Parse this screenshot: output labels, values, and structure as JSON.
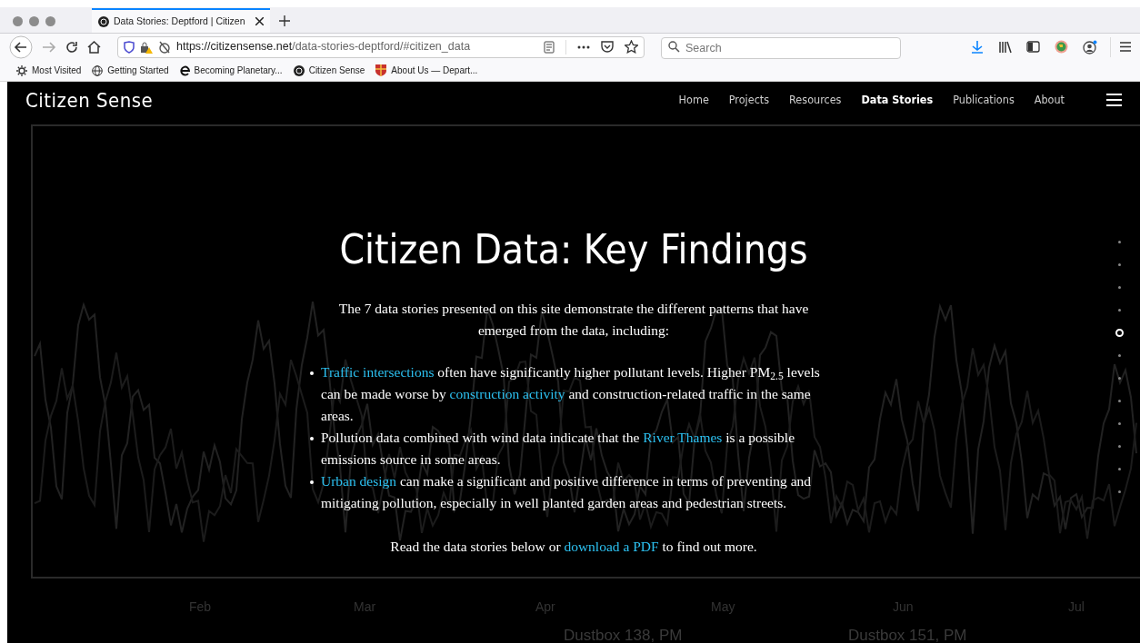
{
  "browser": {
    "tabs": [
      {
        "title": "Data Stories: Deptford | Citizen",
        "selected": true
      }
    ],
    "url": {
      "host": "https://citizensense.net",
      "path": "/data-stories-deptford/#citizen_data"
    },
    "search": {
      "placeholder": "Search"
    },
    "bookmarks": [
      {
        "label": "Most Visited",
        "kind": "gear"
      },
      {
        "label": "Getting Started",
        "kind": "globe"
      },
      {
        "label": "Becoming Planetary...",
        "kind": "e"
      },
      {
        "label": "Citizen Sense",
        "kind": "cs"
      },
      {
        "label": "About Us — Depart...",
        "kind": "shield"
      }
    ]
  },
  "site": {
    "logo": "Citizen Sense",
    "nav": [
      {
        "label": "Home",
        "selected": false
      },
      {
        "label": "Projects",
        "selected": false
      },
      {
        "label": "Resources",
        "selected": false
      },
      {
        "label": "Data Stories",
        "selected": true
      },
      {
        "label": "Publications",
        "selected": false
      },
      {
        "label": "About",
        "selected": false
      }
    ],
    "heading": "Citizen Data: Key Findings",
    "intro": "The 7 data stories presented on this site demonstrate the different patterns that have emerged from the data, including:",
    "bullets": [
      [
        {
          "kind": "link",
          "text": "Traffic intersections"
        },
        {
          "kind": "text",
          "text": "often have significantly higher pollutant levels. Higher PM$_{2.5}$ levels can be made worse by"
        },
        {
          "kind": "link",
          "text": "construction activity"
        },
        {
          "kind": "text",
          "text": "and construction-related traffic in the same areas."
        }
      ],
      [
        {
          "kind": "text",
          "text": "Pollution data combined with wind data indicate that the"
        },
        {
          "kind": "link",
          "text": "River Thames"
        },
        {
          "kind": "text",
          "text": "is a possible emissions source in some areas."
        }
      ],
      [
        {
          "kind": "link",
          "text": "Urban design"
        },
        {
          "kind": "text",
          "text": "can make a significant and positive difference in terms of preventing and mitigating pollution, especially in well planted garden areas and pedestrian streets."
        }
      ]
    ],
    "outro": [
      {
        "kind": "text",
        "text": "Read the data stories below or"
      },
      {
        "kind": "link",
        "text": "download a PDF"
      },
      {
        "kind": "text",
        "text": "to find out more."
      }
    ],
    "section_dots": [
      {
        "selected": false
      },
      {
        "selected": false
      },
      {
        "selected": false
      },
      {
        "selected": false
      },
      {
        "selected": true
      },
      {
        "selected": false
      },
      {
        "selected": false
      },
      {
        "selected": false
      },
      {
        "selected": false
      },
      {
        "selected": false
      },
      {
        "selected": false
      },
      {
        "selected": false
      }
    ],
    "background_chart": {
      "x_labels": [
        "Feb",
        "Mar",
        "Apr",
        "May",
        "Jun",
        "Jul"
      ],
      "legend": [
        "Dustbox 138, PM",
        "Dustbox 151, PM"
      ]
    }
  }
}
